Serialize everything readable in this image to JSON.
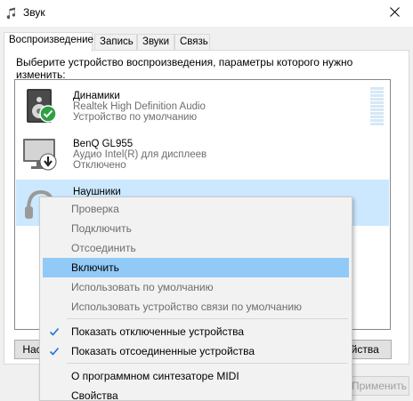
{
  "window": {
    "title": "Звук",
    "tabs": [
      "Воспроизведение",
      "Запись",
      "Звуки",
      "Связь"
    ]
  },
  "instruction": "Выберите устройство воспроизведения, параметры которого нужно изменить:",
  "devices": [
    {
      "name": "Динамики",
      "line2": "Realtek High Definition Audio",
      "line3": "Устройство по умолчанию",
      "icon": "speaker-icon",
      "badge": "default-check-icon"
    },
    {
      "name": "BenQ GL955",
      "line2": "Аудио Intel(R) для дисплеев",
      "line3": "Отключено",
      "icon": "monitor-icon",
      "badge": "disabled-arrow-icon"
    },
    {
      "name": "Наушники",
      "icon": "headphones-icon"
    }
  ],
  "buttons": {
    "configure": "Нас",
    "properties": "ойства",
    "apply": "Применить"
  },
  "context_menu": [
    {
      "label": "Проверка",
      "enabled": false
    },
    {
      "label": "Подключить",
      "enabled": false
    },
    {
      "label": "Отсоединить",
      "enabled": false
    },
    {
      "label": "Включить",
      "enabled": true,
      "highlighted": true
    },
    {
      "label": "Использовать по умолчанию",
      "enabled": false
    },
    {
      "label": "Использовать устройство связи по умолчанию",
      "enabled": false
    },
    {
      "label": "Показать отключенные устройства",
      "enabled": true,
      "checked": true
    },
    {
      "label": "Показать отсоединенные устройства",
      "enabled": true,
      "checked": true
    },
    {
      "label": "О программном синтезаторе MIDI",
      "enabled": true
    },
    {
      "label": "Свойства",
      "enabled": true
    }
  ],
  "colors": {
    "selection": "#cce8ff",
    "menu_highlight": "#91c9f7",
    "check": "#1a73d9",
    "default_badge": "#2ea043"
  }
}
